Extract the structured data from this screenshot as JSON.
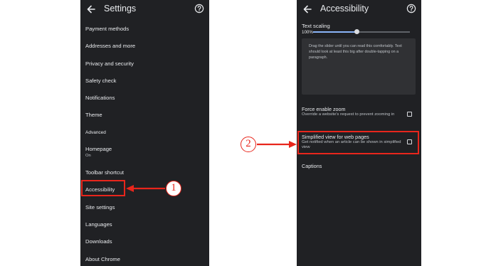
{
  "left_screen": {
    "title": "Settings",
    "items": [
      {
        "label": "Payment methods"
      },
      {
        "label": "Addresses and more"
      },
      {
        "label": "Privacy and security"
      },
      {
        "label": "Safety check"
      },
      {
        "label": "Notifications"
      },
      {
        "label": "Theme"
      },
      {
        "label": "Advanced"
      },
      {
        "label": "Homepage",
        "sub": "On"
      },
      {
        "label": "Toolbar shortcut"
      },
      {
        "label": "Accessibility"
      },
      {
        "label": "Site settings"
      },
      {
        "label": "Languages"
      },
      {
        "label": "Downloads"
      },
      {
        "label": "About Chrome"
      }
    ]
  },
  "right_screen": {
    "title": "Accessibility",
    "text_scaling": {
      "label": "Text scaling",
      "value_text": "100%",
      "slider_fraction": 0.45,
      "preview": "Drag the slider until you can read this comfortably. Text should look at least this big after double-tapping on a paragraph."
    },
    "force_zoom": {
      "title": "Force enable zoom",
      "desc": "Override a website's request to prevent zooming in"
    },
    "simplified_view": {
      "title": "Simplified view for web pages",
      "desc": "Get notified when an article can be shown in simplified view"
    },
    "captions": "Captions"
  },
  "annotations": {
    "step1": "1",
    "step2": "2",
    "color": "#e8261c"
  },
  "colors": {
    "screen_bg": "#202124",
    "text": "#e8eaed",
    "accent": "#8ab4f8"
  },
  "icons": [
    "back-arrow-icon",
    "help-icon",
    "checkbox-icon"
  ]
}
